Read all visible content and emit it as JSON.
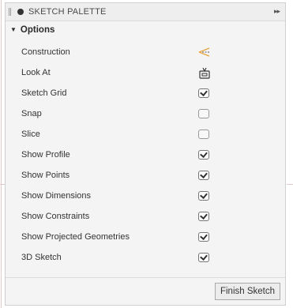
{
  "palette": {
    "title": "SKETCH PALETTE",
    "section_label": "Options",
    "rows": [
      {
        "label": "Construction",
        "control": "construction-icon"
      },
      {
        "label": "Look At",
        "control": "look-at-icon"
      },
      {
        "label": "Sketch Grid",
        "control": "checkbox",
        "checked": true
      },
      {
        "label": "Snap",
        "control": "checkbox",
        "checked": false
      },
      {
        "label": "Slice",
        "control": "checkbox",
        "checked": false
      },
      {
        "label": "Show Profile",
        "control": "checkbox",
        "checked": true
      },
      {
        "label": "Show Points",
        "control": "checkbox",
        "checked": true
      },
      {
        "label": "Show Dimensions",
        "control": "checkbox",
        "checked": true
      },
      {
        "label": "Show Constraints",
        "control": "checkbox",
        "checked": true
      },
      {
        "label": "Show Projected Geometries",
        "control": "checkbox",
        "checked": true
      },
      {
        "label": "3D Sketch",
        "control": "checkbox",
        "checked": true
      }
    ],
    "finish_button": "Finish Sketch",
    "colors": {
      "construction_accent": "#e8a33a"
    }
  }
}
